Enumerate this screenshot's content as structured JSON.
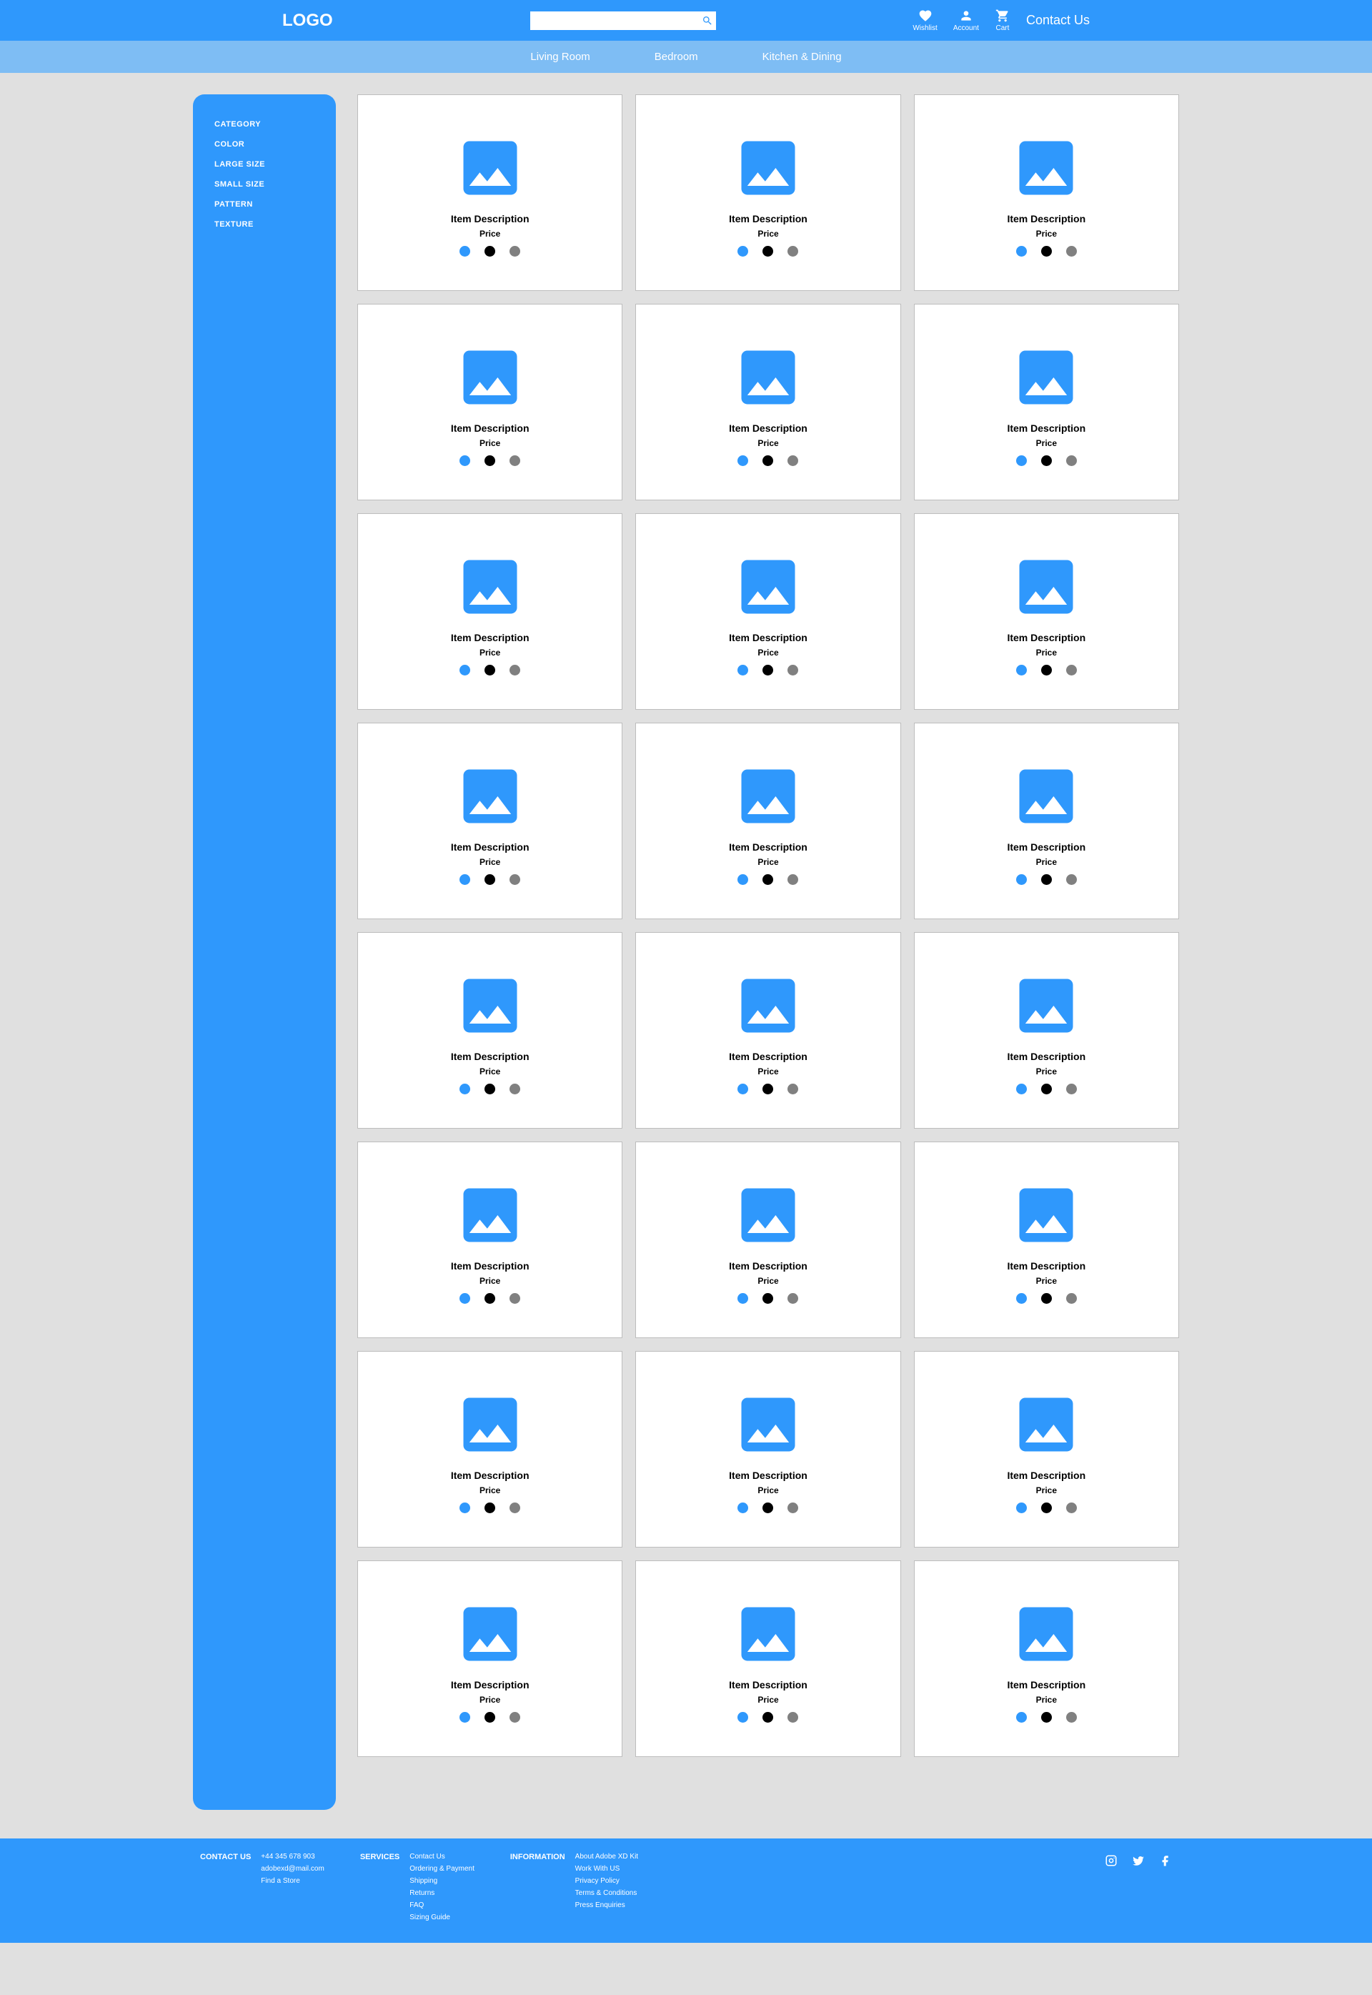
{
  "colors": {
    "primary": "#2f98fc",
    "secondary": "#7ebdf4",
    "bg": "#e0e0e0",
    "swatch1": "#2f98fc",
    "swatch2": "#000000",
    "swatch3": "#808080"
  },
  "header": {
    "logo": "LOGO",
    "search_placeholder": "",
    "icons": [
      {
        "name": "wishlist-icon",
        "label": "Wishlist"
      },
      {
        "name": "account-icon",
        "label": "Account"
      },
      {
        "name": "cart-icon",
        "label": "Cart"
      }
    ],
    "contact": "Contact Us",
    "nav": [
      "Living Room",
      "Bedroom",
      "Kitchen & Dining"
    ]
  },
  "sidebar": {
    "items": [
      "CATEGORY",
      "COLOR",
      "LARGE SIZE",
      "SMALL SIZE",
      "PATTERN",
      "TEXTURE"
    ]
  },
  "product": {
    "desc": "Item Description",
    "price": "Price",
    "count": 24
  },
  "footer": {
    "contact": {
      "heading": "CONTACT US",
      "lines": [
        "+44 345 678 903",
        "adobexd@mail.com",
        "Find a Store"
      ]
    },
    "services": {
      "heading": "SERVICES",
      "links": [
        "Contact Us",
        "Ordering & Payment",
        "Shipping",
        "Returns",
        "FAQ",
        "Sizing Guide"
      ]
    },
    "information": {
      "heading": "INFORMATION",
      "links": [
        "About Adobe XD Kit",
        "Work With US",
        "Privacy Policy",
        "Terms & Conditions",
        "Press Enquiries"
      ]
    }
  }
}
